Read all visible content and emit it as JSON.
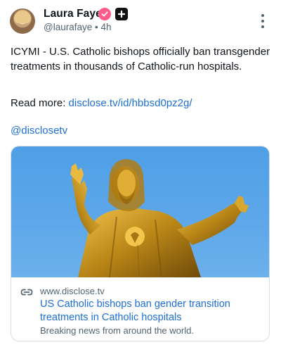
{
  "author": {
    "name": "Laura Faye",
    "handle": "@laurafaye",
    "separator": "•",
    "time": "4h",
    "verified_color": "#ff5c8a"
  },
  "post": {
    "text": "ICYMI - U.S. Catholic bishops officially ban transgender treatments in thousands of Catholic-run hospitals.",
    "read_more_label": "Read more: ",
    "read_more_link": "disclose.tv/id/hbbsd0pz2g/",
    "mention": "@disclosetv"
  },
  "card": {
    "domain": "www.disclose.tv",
    "title": "US Catholic bishops ban gender transition treatments in Catholic hospitals",
    "description": "Breaking news from around the world.",
    "image_subject": "golden Jesus statue with outstretched arms against blue sky"
  },
  "icons": {
    "verified": "verified-badge-icon",
    "plus": "plus-badge-icon",
    "more": "more-options-icon",
    "link": "link-icon"
  },
  "colors": {
    "link": "#1d6fd8",
    "muted": "#536471",
    "text": "#0f1419"
  }
}
